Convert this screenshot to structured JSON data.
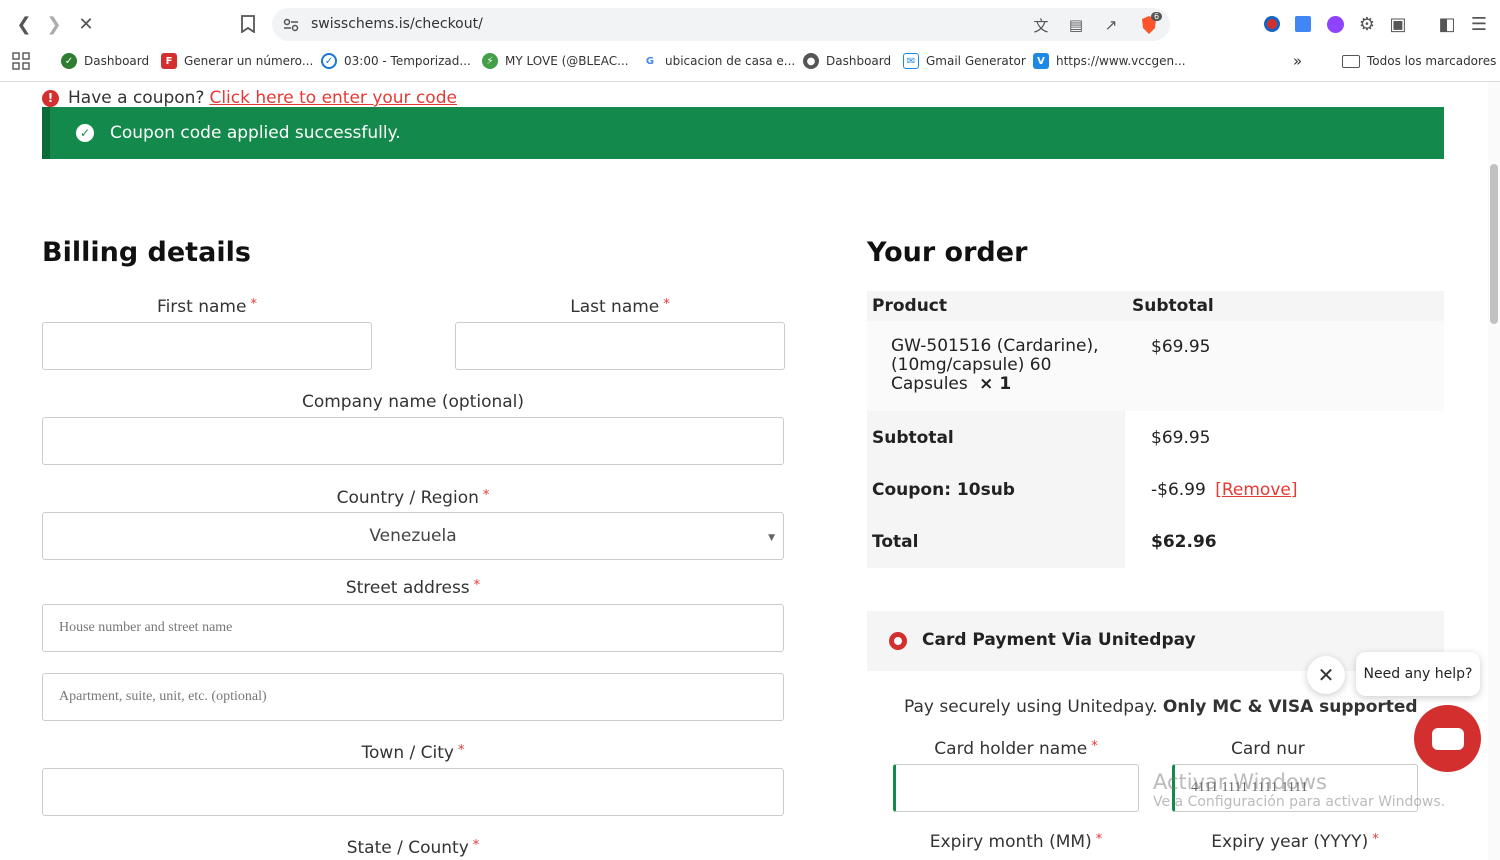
{
  "browser": {
    "url": "swisschems.is/checkout/",
    "shield_count": "6",
    "bookmarks": [
      {
        "label": "Dashboard",
        "color": "#2e7d32"
      },
      {
        "label": "Generar un número...",
        "color": "#d32f2f",
        "glyph": "F"
      },
      {
        "label": "03:00 - Temporizad...",
        "color": "#1976d2"
      },
      {
        "label": "MY LOVE (@BLEAC...",
        "color": "#43a047"
      },
      {
        "label": "ubicacion de casa e...",
        "color": "#fff",
        "glyph": "G"
      },
      {
        "label": "Dashboard",
        "color": "#555"
      },
      {
        "label": "Gmail Generator",
        "color": "#1e88e5"
      },
      {
        "label": "https://www.vccgen...",
        "color": "#1e88e5",
        "glyph": "V"
      }
    ],
    "all_bookmarks": "Todos los marcadores"
  },
  "notice": {
    "text": "Have a coupon?",
    "link": "Click here to enter your code",
    "success": "Coupon code applied successfully."
  },
  "billing": {
    "title": "Billing details",
    "first_name": "First name",
    "last_name": "Last name",
    "company": "Company name (optional)",
    "country": "Country / Region",
    "country_value": "Venezuela",
    "street": "Street address",
    "street_placeholder": "House number and street name",
    "apt_placeholder": "Apartment, suite, unit, etc. (optional)",
    "town": "Town / City",
    "state": "State / County",
    "req": "*"
  },
  "order": {
    "title": "Your order",
    "col_product": "Product",
    "col_subtotal": "Subtotal",
    "product_line1": "GW-501516 (Cardarine),",
    "product_line2": "(10mg/capsule) 60",
    "product_line3": "Capsules",
    "product_qty": "× 1",
    "product_price": "$69.95",
    "subtotal_label": "Subtotal",
    "subtotal_value": "$69.95",
    "coupon_label": "Coupon: 10sub",
    "coupon_value": "-$6.99",
    "coupon_remove": "[Remove]",
    "total_label": "Total",
    "total_value": "$62.96"
  },
  "payment": {
    "method": "Card Payment Via Unitedpay",
    "description": "Pay securely using Unitedpay.",
    "description_bold": "Only MC & VISA supported",
    "card_holder": "Card holder name",
    "card_number": "Card nur",
    "card_number_value": "4111 1111 1111 1111",
    "expiry_month": "Expiry month (MM)",
    "expiry_year": "Expiry year (YYYY)"
  },
  "chat": {
    "prompt": "Need any help?"
  },
  "watermark": {
    "line1": "Activar Windows",
    "line2": "Ve a Configuración para activar Windows."
  }
}
